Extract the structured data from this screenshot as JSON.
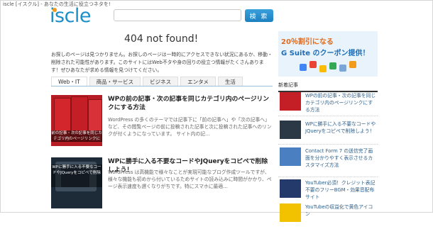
{
  "header": {
    "tagline": "iscle [イスクル] - あなたの生活に役立つネタを!",
    "logo_text": "iscle",
    "search_placeholder": "",
    "search_button": "検 索"
  },
  "main": {
    "heading": "404 not found!",
    "message": "お探しのページは見つかりません。お探しのページは一時的にアクセスできない状況にあるか、移動・削除された可能性があります。このサイトにはWeb不タや身の回りの役立つ情報がたくさんあります！ぜひあなたが求める情報を見つけてください。",
    "tabs": [
      "Web・IT",
      "商品・サービス",
      "ビジネス",
      "エンタメ",
      "生活"
    ]
  },
  "articles": [
    {
      "title": "WPの前の記事・次の記事を同じカテゴリ内のページリンクにする方法",
      "description": "WordPress の多くのテーマでは記事下に「前の記事へ」や「次の記事へ」など、その閲覧ページの前に投稿された記事と次に投稿された記事へのリンクが付くようになっています。 サイト内の記…",
      "thumb_caption": "前の記事・次の記事を同じカテゴリ内のページリンクに"
    },
    {
      "title": "WPに勝手に入る不要なコードやJQueryをコピペで削除しよう！",
      "description": "WordPress は高機能で様々なことが実現可能なブログ作成ツールですが、様々な機能も初めから付いているためサイトの読み込みに時間がかかり、ページ表示速度も遅くなりがちです。特にスマホに最適…",
      "thumb_caption": "WPに勝手に入る不要なコードやJQueryをコピペで削除"
    }
  ],
  "sidebar": {
    "banner_line1": "20％割引になる",
    "banner_line2": "G Suite のクーポン提供！",
    "heading": "新着記事",
    "items": [
      {
        "title": "WPの前の記事・次の記事を同じカテゴリ内のページリンクにする方法",
        "icon": "binder-thumb"
      },
      {
        "title": "WPに勝手に入る不要なコードやJQueryをコピペで削除しよう！",
        "icon": "keyboard-thumb"
      },
      {
        "title": "Contact Form 7 の送信完了画面を分かりやすく表示させるカスタマイズ方法",
        "icon": "form-thumb"
      },
      {
        "title": "YouTuber必須！クレジット表記不要のフリーBGM・効果音配布サイト",
        "icon": "concert-thumb"
      },
      {
        "title": "YouTubeの収益化で黄色アイコン",
        "icon": "youtube-thumb"
      }
    ]
  },
  "colors": {
    "brand_blue": "#1b8fc7",
    "brand_orange": "#f29a1b",
    "link": "#2a5d8a"
  }
}
